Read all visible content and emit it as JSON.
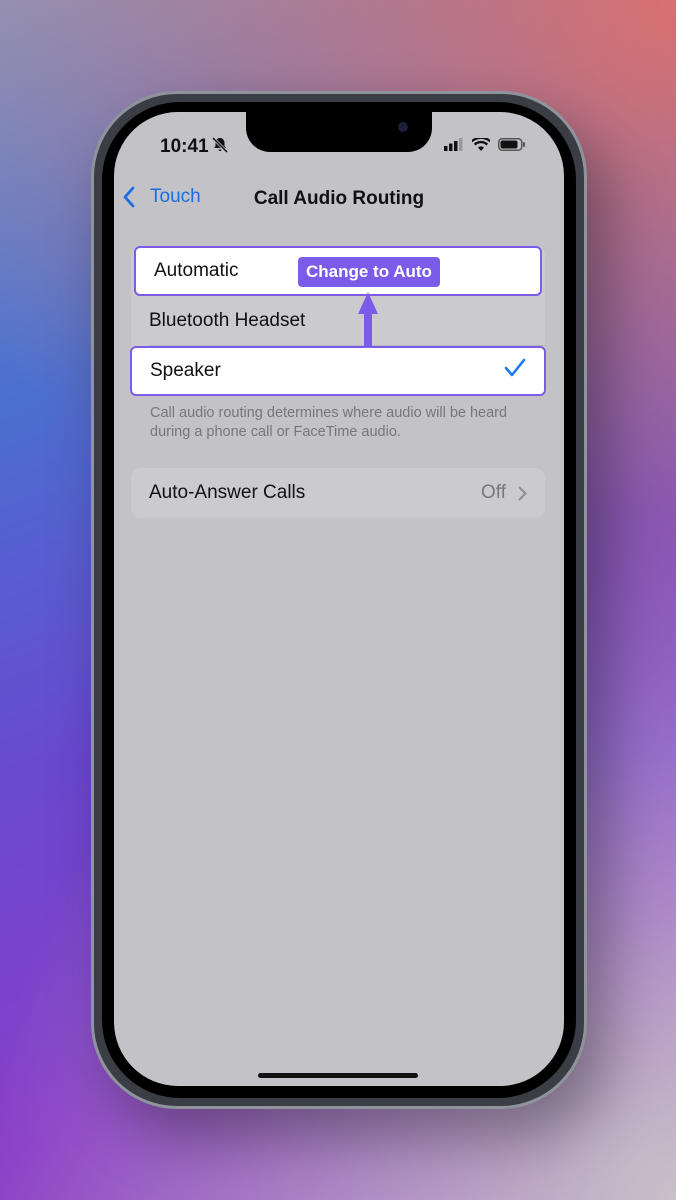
{
  "status_bar": {
    "time": "10:41",
    "silent_icon": "bell-slash-icon",
    "signal_icon": "cellular-icon",
    "wifi_icon": "wifi-icon",
    "battery_icon": "battery-icon"
  },
  "nav": {
    "back_label": "Touch",
    "title": "Call Audio Routing"
  },
  "routing_options": [
    {
      "label": "Automatic",
      "selected": false
    },
    {
      "label": "Bluetooth Headset",
      "selected": false
    },
    {
      "label": "Speaker",
      "selected": true
    }
  ],
  "footer_note": "Call audio routing determines where audio will be heard during a phone call or FaceTime audio.",
  "auto_answer": {
    "label": "Auto-Answer Calls",
    "value": "Off"
  },
  "annotation": {
    "label": "Change to Auto",
    "color": "#7b5ce8"
  },
  "colors": {
    "accent": "#1a7af0",
    "highlight": "#7b5ce8"
  }
}
